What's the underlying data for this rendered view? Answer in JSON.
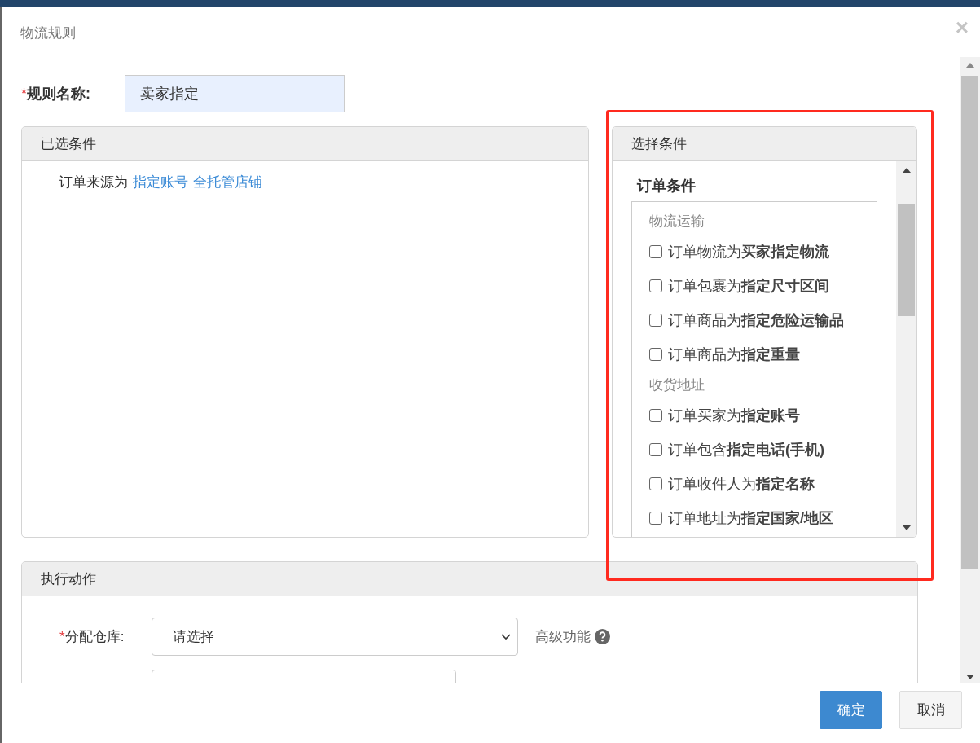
{
  "dialog": {
    "title": "物流规则",
    "close": "×"
  },
  "rule_name": {
    "required_mark": "*",
    "label": "规则名称:",
    "value": "卖家指定"
  },
  "selected_conditions": {
    "title": "已选条件",
    "items": [
      {
        "text": "订单来源为",
        "links": [
          "指定账号",
          "全托管店铺"
        ]
      }
    ]
  },
  "choose_conditions": {
    "title": "选择条件",
    "section": "订单条件",
    "groups": [
      {
        "title": "物流运输",
        "options": [
          {
            "label": "订单物流为**买家指定物流**",
            "checked": false
          },
          {
            "label": "订单包裹为**指定尺寸区间**",
            "checked": false
          },
          {
            "label": "订单商品为**指定危险运输品**",
            "checked": false
          },
          {
            "label": "订单商品为**指定重量**",
            "checked": false
          }
        ]
      },
      {
        "title": "收货地址",
        "options": [
          {
            "label": "订单买家为**指定账号**",
            "checked": false
          },
          {
            "label": "订单包含**指定电话(手机)**",
            "checked": false
          },
          {
            "label": "订单收件人为**指定名称**",
            "checked": false
          },
          {
            "label": "订单地址为**指定国家/地区**",
            "checked": false
          }
        ]
      }
    ]
  },
  "actions": {
    "title": "执行动作",
    "fields": [
      {
        "kind": "select",
        "required_mark": "*",
        "label": "分配仓库:",
        "value": "请选择",
        "extra": "高级功能"
      }
    ]
  },
  "buttons": [
    {
      "label": "确定",
      "primary": true
    },
    {
      "label": "取消",
      "primary": false
    }
  ]
}
